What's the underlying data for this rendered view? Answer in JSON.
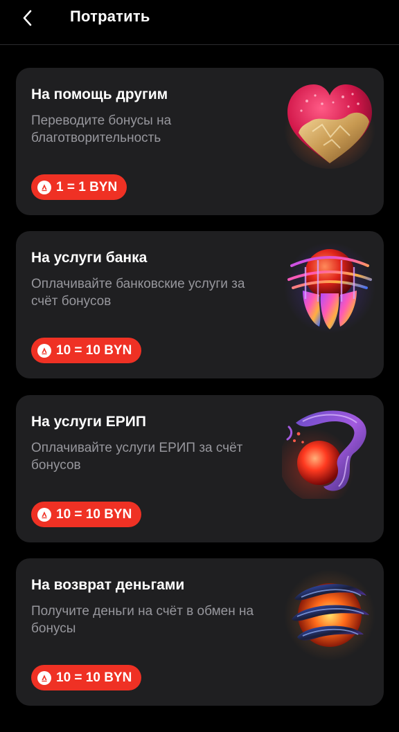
{
  "header": {
    "back_icon": "chevron-left-icon",
    "title": "Потратить"
  },
  "cards": [
    {
      "title": "На помощь другим",
      "description": "Переводите бонусы на благотворительность",
      "badge": "1 = 1 BYN",
      "art": "heart-illustration"
    },
    {
      "title": "На услуги банка",
      "description": "Оплачивайте банковские услуги за счёт бонусов",
      "badge": "10 = 10 BYN",
      "art": "orb-in-cage-illustration"
    },
    {
      "title": "На услуги ЕРИП",
      "description": "Оплачивайте услуги ЕРИП за счёт бонусов",
      "badge": "10 = 10 BYN",
      "art": "tentacle-orb-illustration"
    },
    {
      "title": "На возврат деньгами",
      "description": "Получите деньги на счёт в обмен на бонусы",
      "badge": "10 = 10 BYN",
      "art": "spiral-sphere-illustration"
    }
  ],
  "colors": {
    "background": "#000000",
    "card": "#1f1f21",
    "badge": "#ef3124",
    "muted_text": "#97979d"
  },
  "badge_icon": "alfa-bank-logo-icon"
}
